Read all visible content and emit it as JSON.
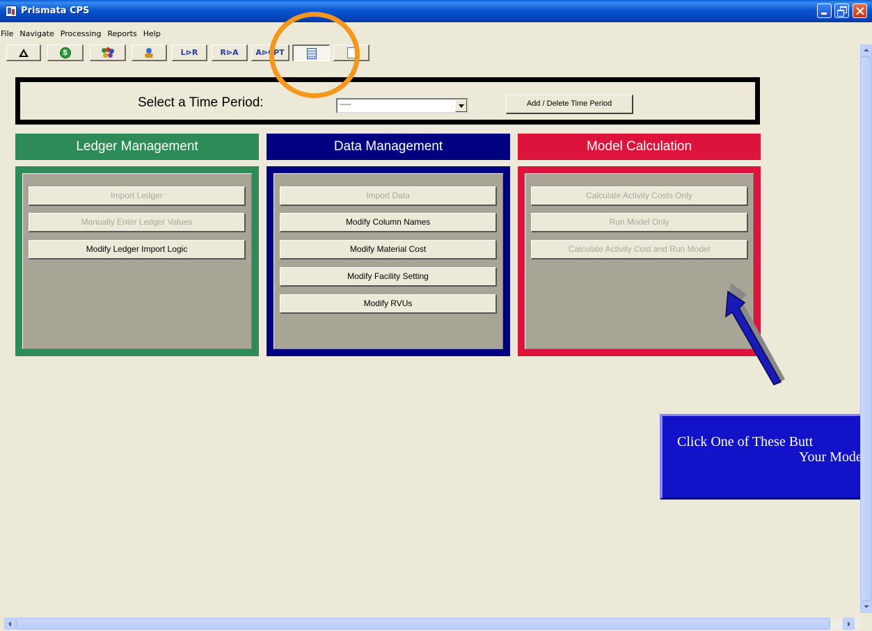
{
  "window": {
    "title": "Prismata CPS"
  },
  "menu": [
    "File",
    "Navigate",
    "Processing",
    "Reports",
    "Help"
  ],
  "toolbar": {
    "buttons": [
      {
        "icon": "delta-icon"
      },
      {
        "icon": "dollar-coin-icon",
        "text": "$"
      },
      {
        "icon": "people-icon"
      },
      {
        "icon": "hand-icon"
      },
      {
        "icon": "text-icon",
        "text": "L⊳R"
      },
      {
        "icon": "text-icon",
        "text": "R⊳A"
      },
      {
        "icon": "text-icon",
        "text": "A⊳CPT"
      },
      {
        "icon": "calculator-icon",
        "pressed": true
      },
      {
        "icon": "page-icon"
      }
    ]
  },
  "time_period": {
    "label": "Select a Time Period:",
    "selected": "-----",
    "add_delete_label": "Add / Delete Time Period"
  },
  "sections": [
    {
      "title": "Ledger Management",
      "color": "#2e8b57",
      "buttons": [
        {
          "label": "Import Ledger",
          "enabled": false
        },
        {
          "label": "Manually Enter Ledger Values",
          "enabled": false
        },
        {
          "label": "Modify Ledger Import Logic",
          "enabled": true
        }
      ]
    },
    {
      "title": "Data Management",
      "color": "#000080",
      "buttons": [
        {
          "label": "Import Data",
          "enabled": false
        },
        {
          "label": "Modify Column Names",
          "enabled": true
        },
        {
          "label": "Modify Material Cost",
          "enabled": true
        },
        {
          "label": "Modify Facility Setting",
          "enabled": true
        },
        {
          "label": "Modify RVUs",
          "enabled": true
        }
      ]
    },
    {
      "title": "Model Calculation",
      "color": "#dc143c",
      "buttons": [
        {
          "label": "Calculate Activity Costs Only",
          "enabled": false
        },
        {
          "label": "Run Model Only",
          "enabled": false
        },
        {
          "label": "Calculate Activity Cost and Run Model",
          "enabled": false
        }
      ]
    }
  ],
  "callout": {
    "line1": "Click One of These Butt",
    "line2": "Your Model",
    "color": "#1212c8"
  },
  "highlight_color": "#f5961e"
}
